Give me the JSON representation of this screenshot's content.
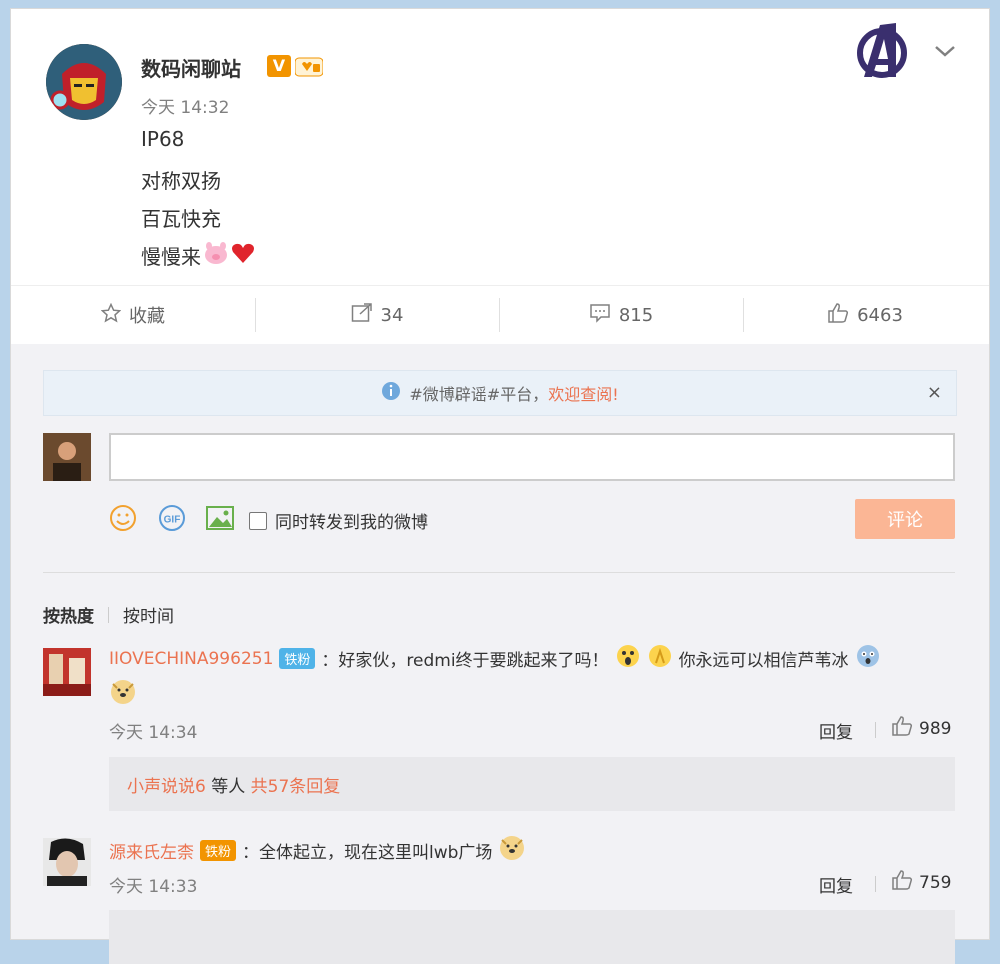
{
  "post": {
    "username": "数码闲聊站",
    "verified_badge": "V",
    "timestamp": "今天 14:32",
    "lines": [
      "IP68",
      "对称双扬",
      "百瓦快充",
      "慢慢来"
    ]
  },
  "actions": {
    "favorite": "收藏",
    "repost_count": "34",
    "comment_count": "815",
    "like_count": "6463"
  },
  "notice": {
    "text": "#微博辟谣#平台，",
    "highlight": "欢迎查阅!",
    "close": "×"
  },
  "composer": {
    "repost_checkbox_label": "同时转发到我的微博",
    "submit": "评论"
  },
  "sort": {
    "by_hot": "按热度",
    "by_time": "按时间"
  },
  "comments": [
    {
      "user": "IIOVECHINA996251",
      "badge": "铁粉",
      "text": "：好家伙，redmi终于要跳起来了吗！",
      "text2": "你永远可以相信芦苇冰",
      "time": "今天 14:34",
      "reply": "回复",
      "likes": "989",
      "sub_user": "小声说说6",
      "sub_mid": " 等人 ",
      "sub_count": "共57条回复"
    },
    {
      "user": "源来氏左柰",
      "badge": "铁粉",
      "text": "：全体起立，现在这里叫lwb广场",
      "time": "今天 14:33",
      "reply": "回复",
      "likes": "759"
    }
  ],
  "colors": {
    "accent": "#eb7350",
    "badge_blue": "#4fb3e8",
    "badge_orange": "#f29400",
    "submit_disabled": "#fbb695"
  }
}
